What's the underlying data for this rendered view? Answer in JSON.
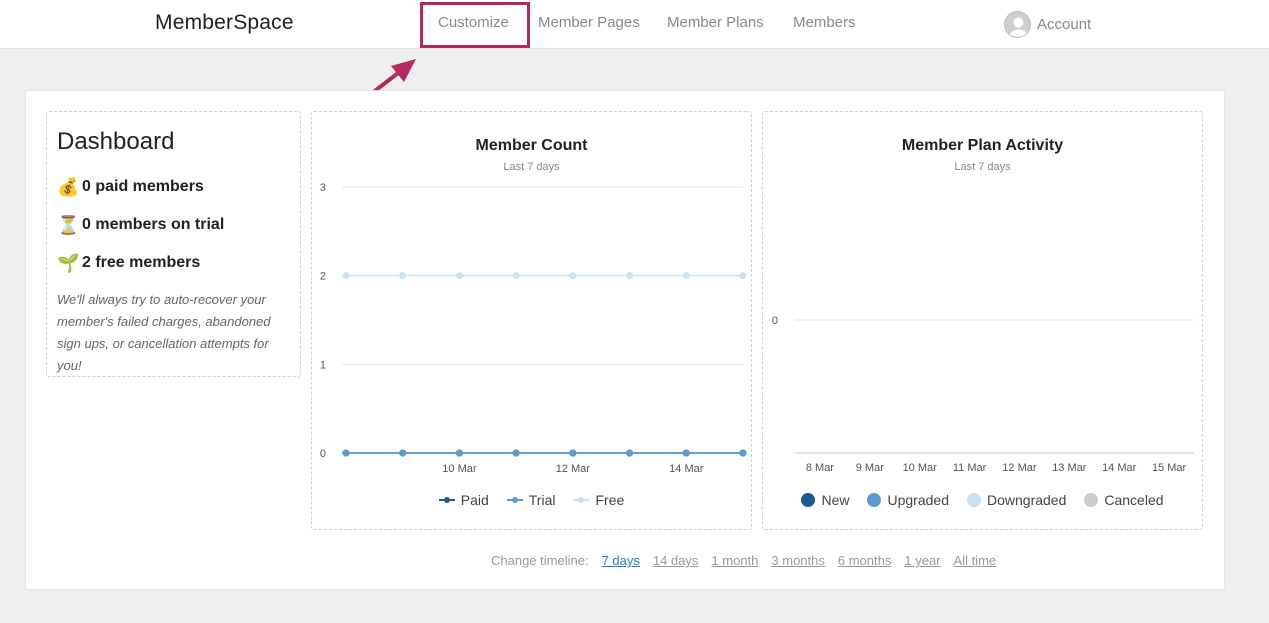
{
  "nav": {
    "logo": "MemberSpace",
    "items": [
      {
        "label": "Customize"
      },
      {
        "label": "Member Pages"
      },
      {
        "label": "Member Plans"
      },
      {
        "label": "Members"
      }
    ],
    "account_label": "Account"
  },
  "dashboard": {
    "title": "Dashboard",
    "stats": [
      {
        "emoji": "💰",
        "text": "0 paid members"
      },
      {
        "emoji": "⏳",
        "text": "0 members on trial"
      },
      {
        "emoji": "🌱",
        "text": "2 free members"
      }
    ],
    "note": "We'll always try to auto-recover your member's failed charges, abandoned sign ups, or cancellation attempts for you!"
  },
  "member_count": {
    "title": "Member Count",
    "subtitle": "Last 7 days",
    "legend": [
      "Paid",
      "Trial",
      "Free"
    ]
  },
  "plan_activity": {
    "title": "Member Plan Activity",
    "subtitle": "Last 7 days",
    "legend": [
      "New",
      "Upgraded",
      "Downgraded",
      "Canceled"
    ]
  },
  "timeline": {
    "label": "Change timeline:",
    "options": [
      "7 days",
      "14 days",
      "1 month",
      "3 months",
      "6 months",
      "1 year",
      "All time"
    ],
    "active": "7 days"
  },
  "colors": {
    "paid": "#1f5b93",
    "trial": "#5b9bd0",
    "free": "#c9e1f3",
    "canceled": "#cccccc",
    "highlight": "#b5295e",
    "link_active": "#2a7fc1"
  },
  "chart_data": [
    {
      "type": "line",
      "title": "Member Count",
      "subtitle": "Last 7 days",
      "x": [
        "8 Mar",
        "9 Mar",
        "10 Mar",
        "11 Mar",
        "12 Mar",
        "13 Mar",
        "14 Mar",
        "15 Mar"
      ],
      "x_tick_labels": [
        "10 Mar",
        "12 Mar",
        "14 Mar"
      ],
      "ylim": [
        0,
        3
      ],
      "y_ticks": [
        0,
        1,
        2,
        3
      ],
      "series": [
        {
          "name": "Paid",
          "values": [
            0,
            0,
            0,
            0,
            0,
            0,
            0,
            0
          ]
        },
        {
          "name": "Trial",
          "values": [
            0,
            0,
            0,
            0,
            0,
            0,
            0,
            0
          ]
        },
        {
          "name": "Free",
          "values": [
            2,
            2,
            2,
            2,
            2,
            2,
            2,
            2
          ]
        }
      ],
      "legend_position": "bottom",
      "grid": true
    },
    {
      "type": "bar",
      "title": "Member Plan Activity",
      "subtitle": "Last 7 days",
      "categories": [
        "8 Mar",
        "9 Mar",
        "10 Mar",
        "11 Mar",
        "12 Mar",
        "13 Mar",
        "14 Mar",
        "15 Mar"
      ],
      "y_ticks": [
        0
      ],
      "series": [
        {
          "name": "New",
          "values": [
            0,
            0,
            0,
            0,
            0,
            0,
            0,
            0
          ]
        },
        {
          "name": "Upgraded",
          "values": [
            0,
            0,
            0,
            0,
            0,
            0,
            0,
            0
          ]
        },
        {
          "name": "Downgraded",
          "values": [
            0,
            0,
            0,
            0,
            0,
            0,
            0,
            0
          ]
        },
        {
          "name": "Canceled",
          "values": [
            0,
            0,
            0,
            0,
            0,
            0,
            0,
            0
          ]
        }
      ],
      "legend_position": "bottom",
      "grid": true
    }
  ]
}
